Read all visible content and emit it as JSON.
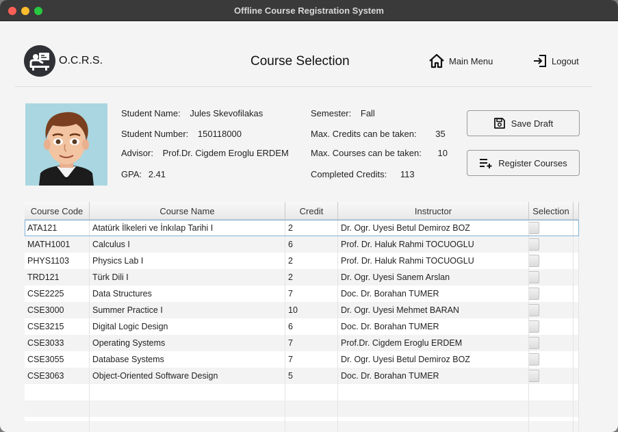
{
  "window": {
    "title": "Offline Course Registration System"
  },
  "header": {
    "brand": "O.C.R.S.",
    "page_title": "Course Selection",
    "main_menu_label": "Main Menu",
    "logout_label": "Logout"
  },
  "student": {
    "name_label": "Student Name:",
    "name": "Jules Skevofilakas",
    "number_label": "Student Number:",
    "number": "150118000",
    "advisor_label": "Advisor:",
    "advisor": "Prof.Dr. Cigdem Eroglu ERDEM",
    "gpa_label": "GPA:",
    "gpa": "2.41",
    "semester_label": "Semester:",
    "semester": "Fall",
    "max_credits_label": "Max. Credits can be taken:",
    "max_credits": "35",
    "max_courses_label": "Max. Courses can be taken:",
    "max_courses": "10",
    "completed_credits_label": "Completed Credits:",
    "completed_credits": "113"
  },
  "actions": {
    "save_draft": "Save Draft",
    "register_courses": "Register Courses"
  },
  "table": {
    "columns": [
      "Course Code",
      "Course Name",
      "Credit",
      "Instructor",
      "Selection"
    ],
    "rows": [
      {
        "code": "ATA121",
        "name": "Atatürk İlkeleri ve İnkılap Tarihi I",
        "credit": "2",
        "instructor": "Dr. Ogr. Uyesi Betul Demiroz BOZ",
        "selected": false
      },
      {
        "code": "MATH1001",
        "name": "Calculus I",
        "credit": "6",
        "instructor": "Prof. Dr. Haluk Rahmi TOCUOGLU",
        "selected": false
      },
      {
        "code": "PHYS1103",
        "name": "Physics Lab I",
        "credit": "2",
        "instructor": "Prof. Dr. Haluk Rahmi TOCUOGLU",
        "selected": false
      },
      {
        "code": "TRD121",
        "name": "Türk Dili I",
        "credit": "2",
        "instructor": "Dr. Ogr. Uyesi Sanem Arslan",
        "selected": false
      },
      {
        "code": "CSE2225",
        "name": "Data Structures",
        "credit": "7",
        "instructor": "Doc. Dr. Borahan TUMER",
        "selected": false
      },
      {
        "code": "CSE3000",
        "name": "Summer Practice I",
        "credit": "10",
        "instructor": "Dr. Ogr. Uyesi Mehmet BARAN",
        "selected": false
      },
      {
        "code": "CSE3215",
        "name": "Digital Logic Design",
        "credit": "6",
        "instructor": "Doc. Dr. Borahan TUMER",
        "selected": false
      },
      {
        "code": "CSE3033",
        "name": "Operating Systems",
        "credit": "7",
        "instructor": "Prof.Dr. Cigdem Eroglu ERDEM",
        "selected": false
      },
      {
        "code": "CSE3055",
        "name": "Database Systems",
        "credit": "7",
        "instructor": "Dr. Ogr. Uyesi Betul Demiroz BOZ",
        "selected": false
      },
      {
        "code": "CSE3063",
        "name": "Object-Oriented Software Design",
        "credit": "5",
        "instructor": "Doc. Dr. Borahan TUMER",
        "selected": false
      }
    ]
  }
}
